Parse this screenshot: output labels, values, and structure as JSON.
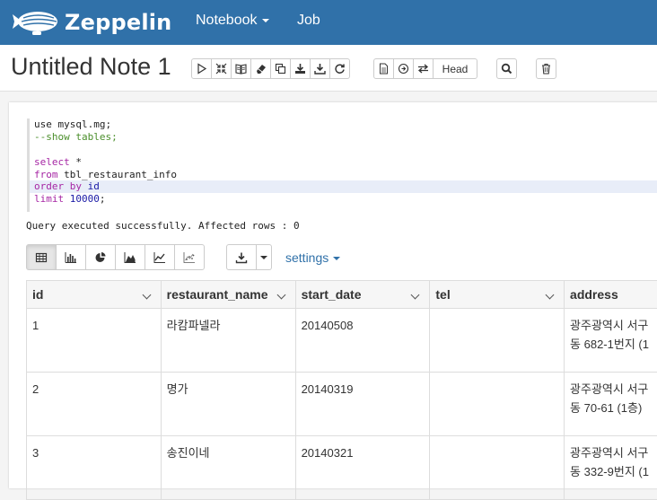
{
  "navbar": {
    "brand": "Zeppelin",
    "menu": {
      "notebook": "Notebook",
      "job": "Job"
    }
  },
  "header": {
    "title": "Untitled Note 1",
    "head_label": "Head"
  },
  "paragraph": {
    "code": [
      "use mysql.mg;",
      "--show tables;",
      "",
      "select *",
      "from tbl_restaurant_info",
      "order by id",
      "limit 10000;"
    ],
    "result_message": "Query executed successfully. Affected rows : 0",
    "settings_label": "settings"
  },
  "table": {
    "columns": [
      "id",
      "restaurant_name",
      "start_date",
      "tel",
      "address"
    ],
    "rows": [
      {
        "id": "1",
        "restaurant_name": "라캄파넬라",
        "start_date": "20140508",
        "tel": "",
        "address_line1": "광주광역시 서구",
        "address_line2": "동 682-1번지 (1"
      },
      {
        "id": "2",
        "restaurant_name": "명가",
        "start_date": "20140319",
        "tel": "",
        "address_line1": "광주광역시 서구",
        "address_line2": "동 70-61 (1층)"
      },
      {
        "id": "3",
        "restaurant_name": "송진이네",
        "start_date": "20140321",
        "tel": "",
        "address_line1": "광주광역시 서구",
        "address_line2": "동 332-9번지 (1"
      }
    ]
  },
  "colors": {
    "navbar": "#3071a9",
    "link": "#3071a9",
    "keyword": "#a626a4",
    "comment": "#4a8e2a"
  }
}
